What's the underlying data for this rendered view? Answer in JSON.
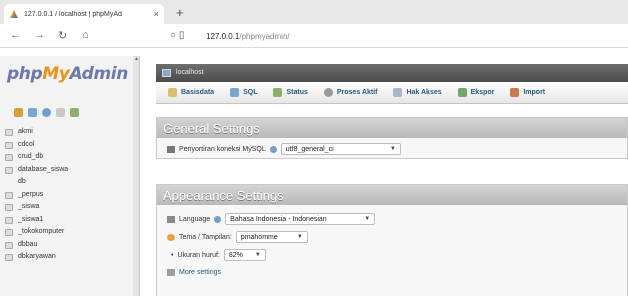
{
  "browser": {
    "tab_title": "127.0.0.1 / localhost | phpMyAd",
    "tab_close": "×",
    "new_tab": "+",
    "url_host": "127.0.0.1",
    "url_path": "/phpmyadmin/"
  },
  "logo": {
    "php": "php",
    "my": "My",
    "admin": "Admin"
  },
  "databases": [
    "akmi",
    "cdcol",
    "crud_db",
    "database_siswa",
    "db",
    "_perpus",
    "_siswa",
    "_siswa1",
    "_tokokomputer",
    "dbbau",
    "dbkaryawan"
  ],
  "server_label": "localhost",
  "tabs": [
    {
      "label": "Basisdata",
      "color": "#d8c070"
    },
    {
      "label": "SQL",
      "color": "#7aa6d6"
    },
    {
      "label": "Status",
      "color": "#8fb06a"
    },
    {
      "label": "Proses Aktif",
      "color": "#9a9a9a"
    },
    {
      "label": "Hak Akses",
      "color": "#aab6c8"
    },
    {
      "label": "Ekspor",
      "color": "#6fa86a"
    },
    {
      "label": "Import",
      "color": "#c97a4a"
    }
  ],
  "general": {
    "title": "General Settings",
    "collation_label": "Penyortiran koneksi MySQL",
    "collation_value": "utf8_general_ci"
  },
  "appearance": {
    "title": "Appearance Settings",
    "language_label": "Language",
    "language_value": "Bahasa Indonesia - Indonesian",
    "theme_label": "Tema / Tampilan:",
    "theme_value": "pmahomme",
    "font_label": "Ukuran huruf:",
    "font_value": "82%",
    "more_settings": "More settings"
  }
}
